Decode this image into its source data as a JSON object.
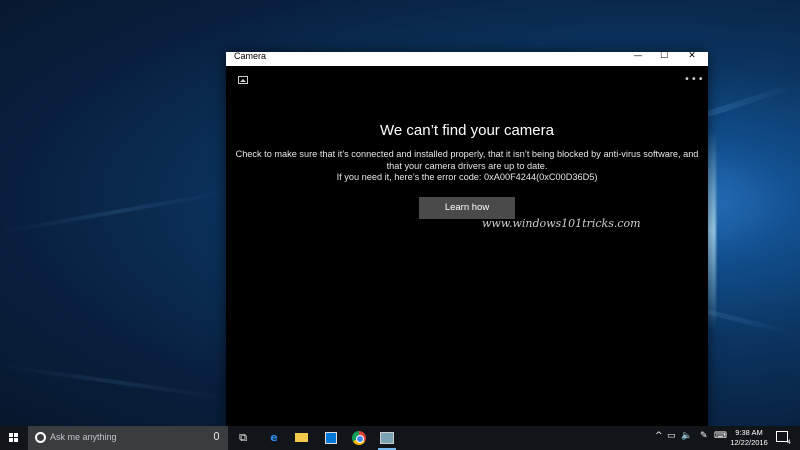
{
  "window": {
    "title": "Camera",
    "controls": {
      "minimize": "—",
      "maximize": "☐",
      "close": "✕"
    },
    "more_glyph": "•••"
  },
  "error": {
    "title": "We can’t find your camera",
    "message": "Check to make sure that it’s connected and installed properly, that it isn’t being blocked by anti-virus software, and that your camera drivers are up to date.",
    "code_line": "If you need it, here’s the error code: 0xA00F4244(0xC00D36D5)",
    "button": "Learn how"
  },
  "watermark": "www.windows101tricks.com",
  "taskbar": {
    "search_placeholder": "Ask me anything",
    "tray": {
      "chevron": "^",
      "time": "9:38 AM",
      "date": "12/22/2016",
      "notifications_count": "4"
    }
  }
}
